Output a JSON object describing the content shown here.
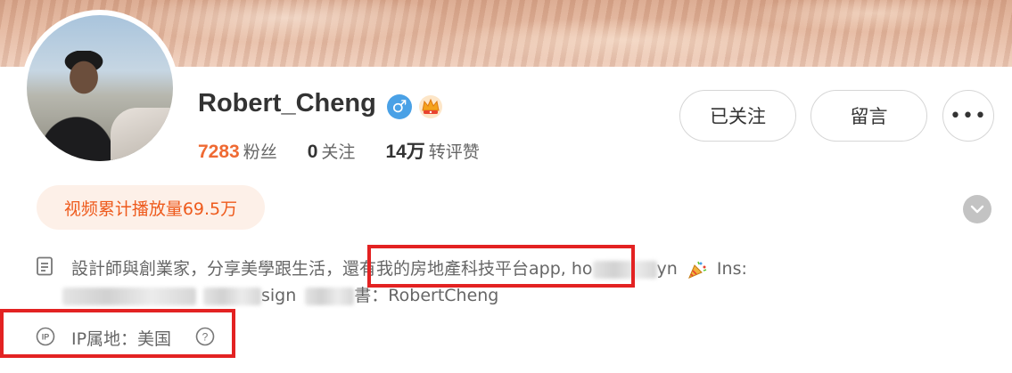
{
  "profile": {
    "username": "Robert_Cheng",
    "gender_icon": "male-icon",
    "badge_icon": "crown-icon",
    "gender_symbol": "♂"
  },
  "stats": [
    {
      "num": "7283",
      "label": "粉丝"
    },
    {
      "num": "0",
      "label": "关注"
    },
    {
      "num": "14万",
      "label": "转评赞"
    }
  ],
  "actions": {
    "follow_label": "已关注",
    "message_label": "留言",
    "more_label": "•••"
  },
  "video_badge": "视频累计播放量69.5万",
  "bio": {
    "line1_a": "設計師與創業家，分享美學跟生活，",
    "line1_b": "還有我的房地產科技平台app, ho",
    "line1_c": "yn",
    "line1_d": "Ins:",
    "line2_a": "sign",
    "line2_b": "書：RobertCheng"
  },
  "ip": {
    "text": "IP属地：美国"
  },
  "colors": {
    "accent_orange": "#ef6a33",
    "gender_blue": "#4aa1e6",
    "highlight_red": "#e32222"
  }
}
